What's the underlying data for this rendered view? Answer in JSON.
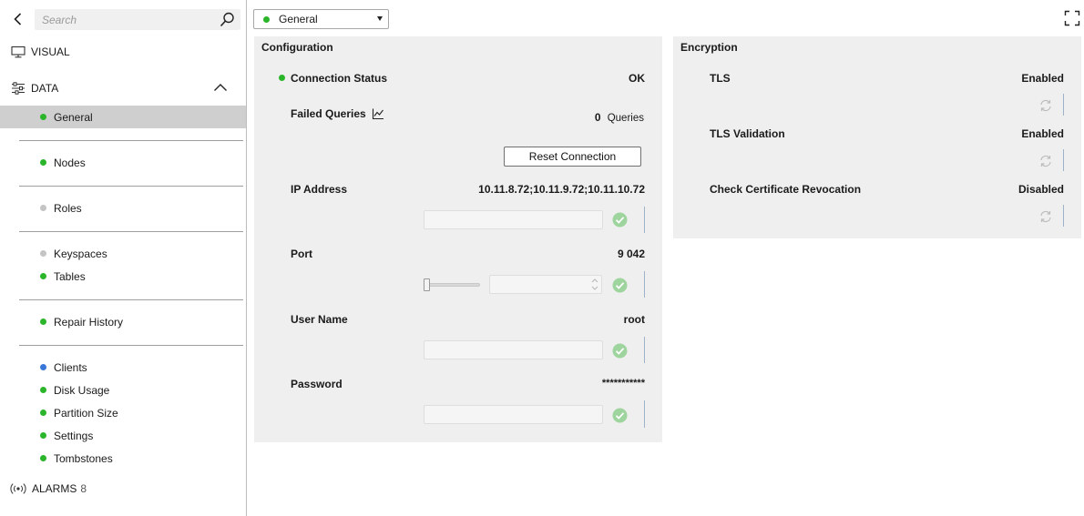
{
  "search": {
    "placeholder": "Search"
  },
  "nav": {
    "visual_label": "VISUAL",
    "data_label": "DATA",
    "alarms_label": "ALARMS",
    "alarms_count": "8"
  },
  "sidebar": {
    "items": [
      {
        "label": "General",
        "status": "green",
        "selected": true
      },
      {
        "label": "Nodes",
        "status": "green"
      },
      {
        "label": "Roles",
        "status": "gray"
      },
      {
        "label": "Keyspaces",
        "status": "gray"
      },
      {
        "label": "Tables",
        "status": "green"
      },
      {
        "label": "Repair History",
        "status": "green"
      },
      {
        "label": "Clients",
        "status": "blue"
      },
      {
        "label": "Disk Usage",
        "status": "green"
      },
      {
        "label": "Partition Size",
        "status": "green"
      },
      {
        "label": "Settings",
        "status": "green"
      },
      {
        "label": "Tombstones",
        "status": "green"
      }
    ]
  },
  "topbar": {
    "view_select": "General"
  },
  "configuration": {
    "title": "Configuration",
    "connection_status_label": "Connection Status",
    "connection_status_value": "OK",
    "failed_queries_label": "Failed Queries",
    "failed_queries_value": "0",
    "failed_queries_unit": "Queries",
    "reset_button": "Reset Connection",
    "ip_label": "IP Address",
    "ip_value": "10.11.8.72;10.11.9.72;10.11.10.72",
    "port_label": "Port",
    "port_value": "9 042",
    "user_label": "User Name",
    "user_value": "root",
    "password_label": "Password",
    "password_value": "***********"
  },
  "encryption": {
    "title": "Encryption",
    "tls_label": "TLS",
    "tls_value": "Enabled",
    "tls_validation_label": "TLS Validation",
    "tls_validation_value": "Enabled",
    "revocation_label": "Check Certificate Revocation",
    "revocation_value": "Disabled"
  },
  "colors": {
    "green": "#2bb52b",
    "gray": "#c4c4c4",
    "blue": "#3a76d8",
    "selected_bg": "#cfcfcf",
    "panel_bg": "#efefef",
    "check_green": "#9ed49e"
  }
}
